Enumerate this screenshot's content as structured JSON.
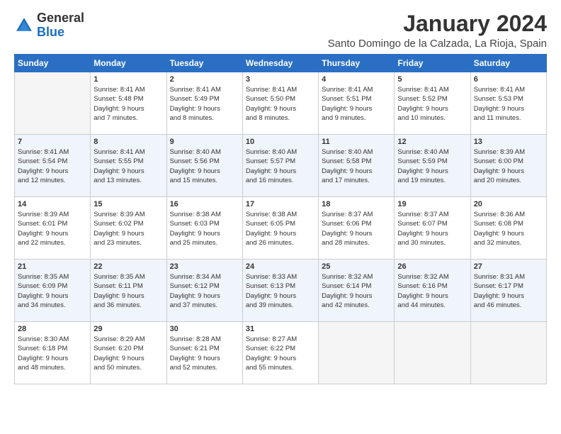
{
  "header": {
    "logo_general": "General",
    "logo_blue": "Blue",
    "month_title": "January 2024",
    "subtitle": "Santo Domingo de la Calzada, La Rioja, Spain"
  },
  "columns": [
    "Sunday",
    "Monday",
    "Tuesday",
    "Wednesday",
    "Thursday",
    "Friday",
    "Saturday"
  ],
  "weeks": [
    [
      {
        "day": "",
        "content": ""
      },
      {
        "day": "1",
        "content": "Sunrise: 8:41 AM\nSunset: 5:48 PM\nDaylight: 9 hours\nand 7 minutes."
      },
      {
        "day": "2",
        "content": "Sunrise: 8:41 AM\nSunset: 5:49 PM\nDaylight: 9 hours\nand 8 minutes."
      },
      {
        "day": "3",
        "content": "Sunrise: 8:41 AM\nSunset: 5:50 PM\nDaylight: 9 hours\nand 8 minutes."
      },
      {
        "day": "4",
        "content": "Sunrise: 8:41 AM\nSunset: 5:51 PM\nDaylight: 9 hours\nand 9 minutes."
      },
      {
        "day": "5",
        "content": "Sunrise: 8:41 AM\nSunset: 5:52 PM\nDaylight: 9 hours\nand 10 minutes."
      },
      {
        "day": "6",
        "content": "Sunrise: 8:41 AM\nSunset: 5:53 PM\nDaylight: 9 hours\nand 11 minutes."
      }
    ],
    [
      {
        "day": "7",
        "content": "Sunrise: 8:41 AM\nSunset: 5:54 PM\nDaylight: 9 hours\nand 12 minutes."
      },
      {
        "day": "8",
        "content": "Sunrise: 8:41 AM\nSunset: 5:55 PM\nDaylight: 9 hours\nand 13 minutes."
      },
      {
        "day": "9",
        "content": "Sunrise: 8:40 AM\nSunset: 5:56 PM\nDaylight: 9 hours\nand 15 minutes."
      },
      {
        "day": "10",
        "content": "Sunrise: 8:40 AM\nSunset: 5:57 PM\nDaylight: 9 hours\nand 16 minutes."
      },
      {
        "day": "11",
        "content": "Sunrise: 8:40 AM\nSunset: 5:58 PM\nDaylight: 9 hours\nand 17 minutes."
      },
      {
        "day": "12",
        "content": "Sunrise: 8:40 AM\nSunset: 5:59 PM\nDaylight: 9 hours\nand 19 minutes."
      },
      {
        "day": "13",
        "content": "Sunrise: 8:39 AM\nSunset: 6:00 PM\nDaylight: 9 hours\nand 20 minutes."
      }
    ],
    [
      {
        "day": "14",
        "content": "Sunrise: 8:39 AM\nSunset: 6:01 PM\nDaylight: 9 hours\nand 22 minutes."
      },
      {
        "day": "15",
        "content": "Sunrise: 8:39 AM\nSunset: 6:02 PM\nDaylight: 9 hours\nand 23 minutes."
      },
      {
        "day": "16",
        "content": "Sunrise: 8:38 AM\nSunset: 6:03 PM\nDaylight: 9 hours\nand 25 minutes."
      },
      {
        "day": "17",
        "content": "Sunrise: 8:38 AM\nSunset: 6:05 PM\nDaylight: 9 hours\nand 26 minutes."
      },
      {
        "day": "18",
        "content": "Sunrise: 8:37 AM\nSunset: 6:06 PM\nDaylight: 9 hours\nand 28 minutes."
      },
      {
        "day": "19",
        "content": "Sunrise: 8:37 AM\nSunset: 6:07 PM\nDaylight: 9 hours\nand 30 minutes."
      },
      {
        "day": "20",
        "content": "Sunrise: 8:36 AM\nSunset: 6:08 PM\nDaylight: 9 hours\nand 32 minutes."
      }
    ],
    [
      {
        "day": "21",
        "content": "Sunrise: 8:35 AM\nSunset: 6:09 PM\nDaylight: 9 hours\nand 34 minutes."
      },
      {
        "day": "22",
        "content": "Sunrise: 8:35 AM\nSunset: 6:11 PM\nDaylight: 9 hours\nand 36 minutes."
      },
      {
        "day": "23",
        "content": "Sunrise: 8:34 AM\nSunset: 6:12 PM\nDaylight: 9 hours\nand 37 minutes."
      },
      {
        "day": "24",
        "content": "Sunrise: 8:33 AM\nSunset: 6:13 PM\nDaylight: 9 hours\nand 39 minutes."
      },
      {
        "day": "25",
        "content": "Sunrise: 8:32 AM\nSunset: 6:14 PM\nDaylight: 9 hours\nand 42 minutes."
      },
      {
        "day": "26",
        "content": "Sunrise: 8:32 AM\nSunset: 6:16 PM\nDaylight: 9 hours\nand 44 minutes."
      },
      {
        "day": "27",
        "content": "Sunrise: 8:31 AM\nSunset: 6:17 PM\nDaylight: 9 hours\nand 46 minutes."
      }
    ],
    [
      {
        "day": "28",
        "content": "Sunrise: 8:30 AM\nSunset: 6:18 PM\nDaylight: 9 hours\nand 48 minutes."
      },
      {
        "day": "29",
        "content": "Sunrise: 8:29 AM\nSunset: 6:20 PM\nDaylight: 9 hours\nand 50 minutes."
      },
      {
        "day": "30",
        "content": "Sunrise: 8:28 AM\nSunset: 6:21 PM\nDaylight: 9 hours\nand 52 minutes."
      },
      {
        "day": "31",
        "content": "Sunrise: 8:27 AM\nSunset: 6:22 PM\nDaylight: 9 hours\nand 55 minutes."
      },
      {
        "day": "",
        "content": ""
      },
      {
        "day": "",
        "content": ""
      },
      {
        "day": "",
        "content": ""
      }
    ]
  ]
}
